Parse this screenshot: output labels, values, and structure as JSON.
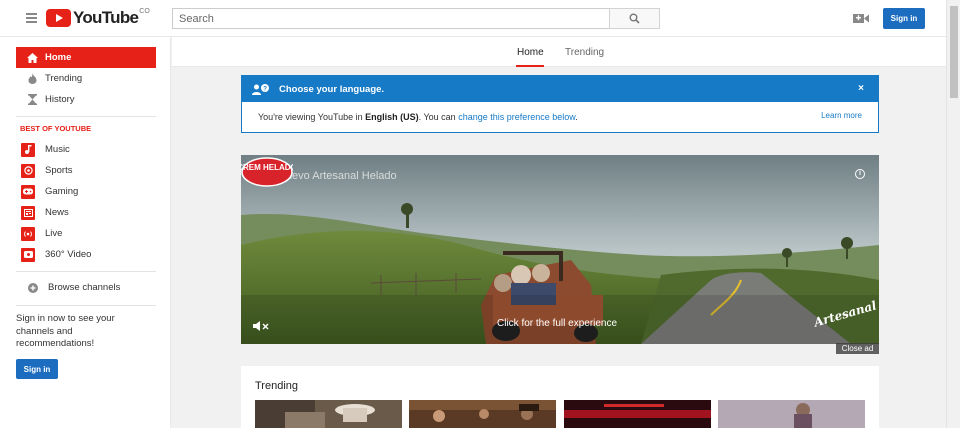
{
  "header": {
    "logo_text": "YouTube",
    "country_code": "CO",
    "search_placeholder": "Search",
    "sign_in_label": "Sign in"
  },
  "sidebar": {
    "nav": [
      {
        "label": "Home",
        "icon": "home-icon",
        "active": true
      },
      {
        "label": "Trending",
        "icon": "flame-icon"
      },
      {
        "label": "History",
        "icon": "hourglass-icon"
      }
    ],
    "section_title": "BEST OF YOUTUBE",
    "categories": [
      {
        "label": "Music",
        "icon": "music-icon"
      },
      {
        "label": "Sports",
        "icon": "sports-icon"
      },
      {
        "label": "Gaming",
        "icon": "gaming-icon"
      },
      {
        "label": "News",
        "icon": "news-icon"
      },
      {
        "label": "Live",
        "icon": "live-icon"
      },
      {
        "label": "360° Video",
        "icon": "360-video-icon"
      }
    ],
    "browse_channels": "Browse channels",
    "signin_prompt": "Sign in now to see your channels and recommendations!",
    "sign_in_label": "Sign in"
  },
  "tabs": {
    "home": "Home",
    "trending": "Trending"
  },
  "language_banner": {
    "title": "Choose your language.",
    "body_prefix": "You're viewing YouTube in ",
    "language": "English (US)",
    "body_middle": ". You can ",
    "link_text": "change this preference below",
    "body_suffix": ".",
    "learn_more": "Learn more",
    "close_glyph": "×"
  },
  "ad": {
    "title": "Nuevo Artesanal Helado",
    "cta": "Click for the full experience",
    "close_label": "Close ad",
    "brand_badge": "CREM HELADO",
    "tagline": "Artesanal"
  },
  "trending": {
    "title": "Trending"
  },
  "colors": {
    "brand_red": "#e62117",
    "link_blue": "#167ac6",
    "button_blue": "#1c6dc0"
  }
}
